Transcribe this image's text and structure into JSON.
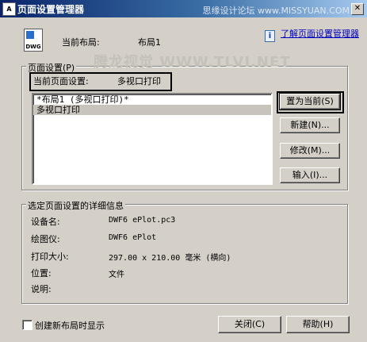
{
  "window": {
    "icon_text": "A",
    "title": "页面设置管理器",
    "watermark": "思缘设计论坛 www.MISSYUAN.COM",
    "close_glyph": "✕"
  },
  "header": {
    "dwg_label": "DWG",
    "current_layout_label": "当前布局:",
    "current_layout_value": "布局1",
    "help_link": "了解页面设置管理器",
    "info_glyph": "i"
  },
  "page_setup": {
    "group_label": "页面设置(P)",
    "current_label": "当前页面设置:",
    "current_value": "多视口打印",
    "watermark": "腾龙视觉 WWW.TLVI.NET",
    "items": [
      "*布局1 (多视口打印)*",
      "多视口打印"
    ],
    "buttons": {
      "set_current": "置为当前(S)",
      "new": "新建(N)...",
      "modify": "修改(M)...",
      "import": "输入(I)..."
    }
  },
  "details": {
    "group_label": "选定页面设置的详细信息",
    "rows": [
      {
        "label": "设备名:",
        "value": "DWF6 ePlot.pc3"
      },
      {
        "label": "绘图仪:",
        "value": "DWF6 ePlot"
      },
      {
        "label": "打印大小:",
        "value": "297.00 x 210.00 毫米 (横向)"
      },
      {
        "label": "位置:",
        "value": "文件"
      },
      {
        "label": "说明:",
        "value": ""
      }
    ]
  },
  "footer": {
    "checkbox_label": "创建新布局时显示",
    "close_button": "关闭(C)",
    "help_button": "帮助(H)"
  }
}
